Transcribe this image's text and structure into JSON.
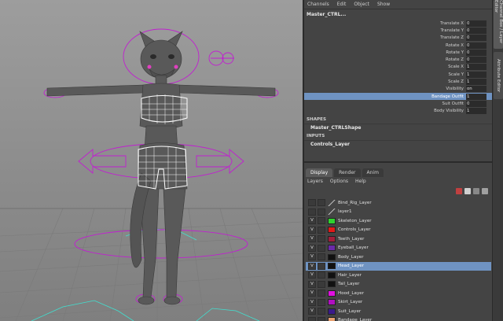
{
  "menu": [
    "Channels",
    "Edit",
    "Object",
    "Show"
  ],
  "object_name": "Master_CTRL...",
  "attributes": [
    {
      "label": "Translate X",
      "value": "0"
    },
    {
      "label": "Translate Y",
      "value": "0"
    },
    {
      "label": "Translate Z",
      "value": "0"
    },
    {
      "label": "Rotate X",
      "value": "0"
    },
    {
      "label": "Rotate Y",
      "value": "0"
    },
    {
      "label": "Rotate Z",
      "value": "0"
    },
    {
      "label": "Scale X",
      "value": "1"
    },
    {
      "label": "Scale Y",
      "value": "1"
    },
    {
      "label": "Scale Z",
      "value": "1"
    },
    {
      "label": "Visibility",
      "value": "on"
    },
    {
      "label": "Bandage Outfit",
      "value": "1",
      "selected": true
    },
    {
      "label": "Suit Outfit",
      "value": "0"
    },
    {
      "label": "Body Visibility",
      "value": "1"
    }
  ],
  "shapes_header": "SHAPES",
  "shape_name": "Master_CTRLShape",
  "inputs_header": "INPUTS",
  "input_name": "Controls_Layer",
  "tabs": [
    {
      "label": "Display",
      "active": true
    },
    {
      "label": "Render",
      "active": false
    },
    {
      "label": "Anim",
      "active": false
    }
  ],
  "layer_menu": [
    "Layers",
    "Options",
    "Help"
  ],
  "layers": [
    {
      "v": "",
      "name": "Bind_Rig_Layer",
      "color": "none"
    },
    {
      "v": "",
      "name": "layer1",
      "color": "none"
    },
    {
      "v": "V",
      "name": "Skeleton_Layer",
      "color": "#2fd12f"
    },
    {
      "v": "V",
      "name": "Controls_Layer",
      "color": "#e01818"
    },
    {
      "v": "V",
      "name": "Teeth_Layer",
      "color": "#a01e3a"
    },
    {
      "v": "V",
      "name": "Eyeball_Layer",
      "color": "#6a2aa8"
    },
    {
      "v": "V",
      "name": "Body_Layer",
      "color": "#111111"
    },
    {
      "v": "V",
      "name": "Head_Layer",
      "color": "#111111",
      "selected": true
    },
    {
      "v": "V",
      "name": "Hair_Layer",
      "color": "#111111"
    },
    {
      "v": "V",
      "name": "Tail_Layer",
      "color": "#111111"
    },
    {
      "v": "V",
      "name": "Hood_Layer",
      "color": "#e010e0"
    },
    {
      "v": "V",
      "name": "Skirt_Layer",
      "color": "#b010c0"
    },
    {
      "v": "V",
      "name": "Suit_Layer",
      "color": "#3a1a8a"
    },
    {
      "v": "",
      "name": "Bandage_Layer",
      "color": "#e8a070"
    }
  ],
  "side_tabs": [
    "Channel Box / Layer Editor",
    "Attribute Editor"
  ],
  "colors": {
    "selection": "#6f93c2",
    "viewport_bg": "#9d9d9d",
    "control_curve": "#c020d0",
    "grid_line": "#707070",
    "cyan_curve": "#40e0d0"
  }
}
